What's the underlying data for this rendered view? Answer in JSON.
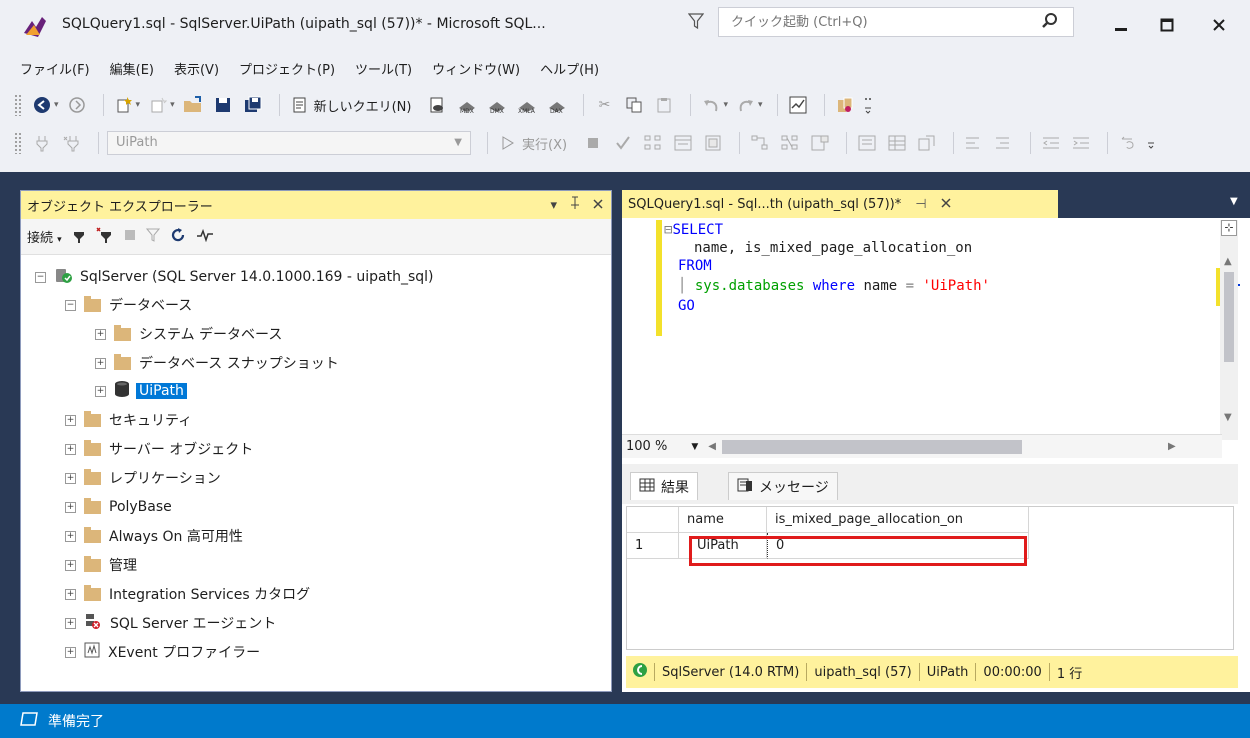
{
  "window": {
    "title": "SQLQuery1.sql - SqlServer.UiPath (uipath_sql (57))* - Microsoft SQL...",
    "quick_launch_placeholder": "クイック起動 (Ctrl+Q)",
    "icons": [
      "ssms-app-icon",
      "filter-icon",
      "search-icon",
      "minimize-icon",
      "maximize-icon",
      "close-icon"
    ]
  },
  "menu": [
    "ファイル(F)",
    "編集(E)",
    "表示(V)",
    "プロジェクト(P)",
    "ツール(T)",
    "ウィンドウ(W)",
    "ヘルプ(H)"
  ],
  "toolbar1": {
    "new_query_label": "新しいクエリ(N)"
  },
  "toolbar2": {
    "database_selected": "UiPath",
    "execute_label": "実行(X)"
  },
  "object_explorer": {
    "title": "オブジェクト エクスプローラー",
    "connect_label": "接続",
    "tree": {
      "server": "SqlServer (SQL Server 14.0.1000.169 - uipath_sql)",
      "databases": "データベース",
      "system_databases": "システム データベース",
      "snapshots": "データベース スナップショット",
      "uipath_db": "UiPath",
      "security": "セキュリティ",
      "server_objects": "サーバー オブジェクト",
      "replication": "レプリケーション",
      "polybase": "PolyBase",
      "always_on": "Always On 高可用性",
      "management": "管理",
      "integration_services": "Integration Services カタログ",
      "sql_agent": "SQL Server エージェント",
      "xevent": "XEvent プロファイラー"
    }
  },
  "editor": {
    "tab_label": "SQLQuery1.sql - Sql...th (uipath_sql (57))*",
    "code": {
      "l1_kw": "SELECT",
      "l2": "name, is_mixed_page_allocation_on",
      "l3_kw": "FROM",
      "l4_sys": "sys.databases",
      "l4_where": "where",
      "l4_mid": "name",
      "l4_eq": "=",
      "l4_str": "'UiPath'",
      "l5_kw": "GO"
    },
    "zoom": "100 %",
    "results_tab": "結果",
    "messages_tab": "メッセージ",
    "grid": {
      "columns": [
        "name",
        "is_mixed_page_allocation_on"
      ],
      "rows": [
        {
          "index": "1",
          "name": "UiPath",
          "is_mixed_page_allocation_on": "0"
        }
      ]
    },
    "status": {
      "server": "SqlServer (14.0 RTM)",
      "login": "uipath_sql (57)",
      "database": "UiPath",
      "elapsed": "00:00:00",
      "rows": "1 行"
    }
  },
  "statusbar": {
    "text": "準備完了"
  },
  "colors": {
    "accent_blue": "#007acc",
    "workspace": "#293955",
    "active_tab_yellow": "#fff29d",
    "highlight_red": "#e01b1b"
  }
}
